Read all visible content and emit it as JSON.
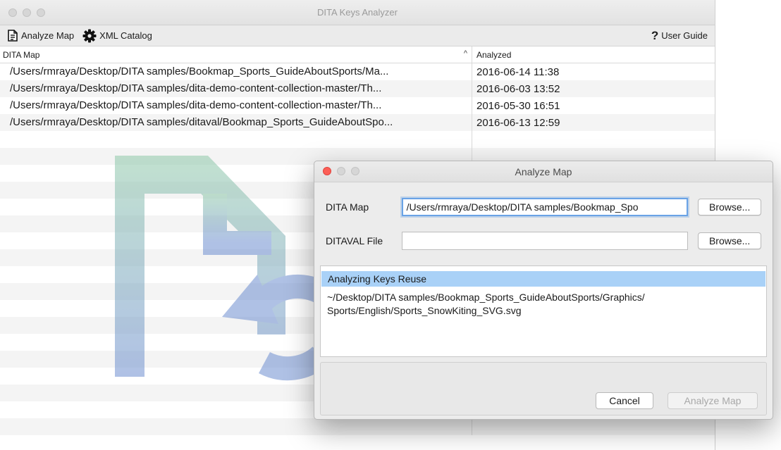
{
  "main_window": {
    "title": "DITA Keys Analyzer",
    "toolbar": {
      "analyze_map_label": "Analyze Map",
      "xml_catalog_label": "XML Catalog",
      "help_symbol": "?",
      "user_guide_label": "User Guide"
    },
    "table": {
      "columns": [
        "DITA Map",
        "Analyzed"
      ],
      "sort_indicator": "^",
      "rows": [
        {
          "map": "/Users/rmraya/Desktop/DITA samples/Bookmap_Sports_GuideAboutSports/Ma...",
          "analyzed": "2016-06-14 11:38"
        },
        {
          "map": "/Users/rmraya/Desktop/DITA samples/dita-demo-content-collection-master/Th...",
          "analyzed": "2016-06-03 13:52"
        },
        {
          "map": "/Users/rmraya/Desktop/DITA samples/dita-demo-content-collection-master/Th...",
          "analyzed": "2016-05-30 16:51"
        },
        {
          "map": "/Users/rmraya/Desktop/DITA samples/ditaval/Bookmap_Sports_GuideAboutSpo...",
          "analyzed": "2016-06-13 12:59"
        }
      ]
    }
  },
  "dialog": {
    "title": "Analyze Map",
    "dita_map_label": "DITA Map",
    "dita_map_value": "/Users/rmraya/Desktop/DITA samples/Bookmap_Spo",
    "ditaval_label": "DITAVAL File",
    "ditaval_value": "",
    "browse_label": "Browse...",
    "log": {
      "selected": "Analyzing Keys Reuse",
      "line": "~/Desktop/DITA samples/Bookmap_Sports_GuideAboutSports/Graphics/ Sports/English/Sports_SnowKiting_SVG.svg"
    },
    "cancel_label": "Cancel",
    "analyze_label": "Analyze Map"
  },
  "colors": {
    "close_dot": "#fc5f57",
    "selection": "#a9d1f7",
    "focus_ring": "#6aa3e6",
    "watermark_green": "#8fc9a9",
    "watermark_blue": "#6f8fd1"
  },
  "icons": {
    "analyze_map": "document-icon",
    "xml_catalog": "gear-icon",
    "user_guide": "question-icon"
  }
}
